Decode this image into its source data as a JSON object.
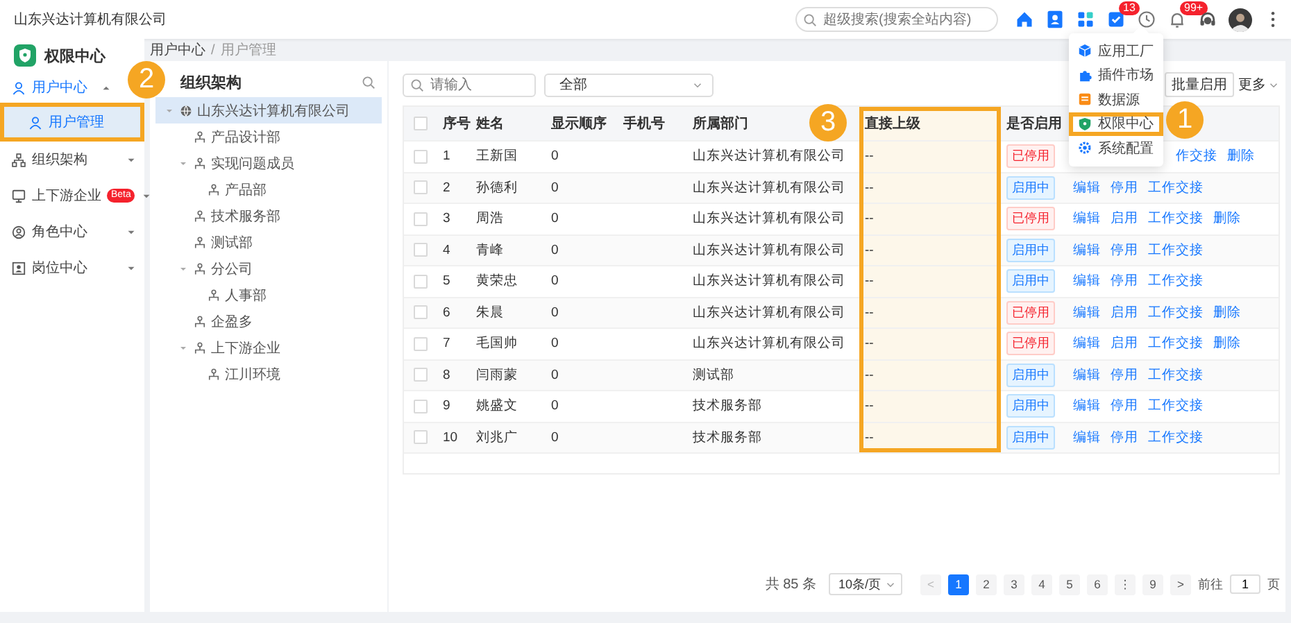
{
  "header": {
    "company": "山东兴达计算机有限公司",
    "search": {
      "placeholder": "超级搜索(搜索全站内容)"
    },
    "icons": [
      {
        "kind": "home"
      },
      {
        "kind": "contacts"
      },
      {
        "kind": "apps"
      },
      {
        "kind": "tasks",
        "badge": "13"
      },
      {
        "kind": "clock"
      },
      {
        "kind": "bell",
        "badge": "99+"
      },
      {
        "kind": "support"
      },
      {
        "kind": "avatar"
      },
      {
        "kind": "more"
      }
    ]
  },
  "menu": {
    "items": [
      {
        "label": "应用工厂",
        "selected": false
      },
      {
        "label": "插件市场",
        "selected": false
      },
      {
        "label": "数据源",
        "selected": false
      },
      {
        "label": "权限中心",
        "selected": false
      },
      {
        "label": "系统配置",
        "selected": false
      }
    ]
  },
  "sidebar": {
    "title": "权限中心",
    "items": [
      {
        "label": "用户中心",
        "expanded": true,
        "selected": false,
        "children": [
          {
            "label": "用户管理",
            "selected": true
          }
        ]
      },
      {
        "label": "组织架构",
        "expanded": false,
        "selected": false
      },
      {
        "label": "上下游企业",
        "badge": "Beta",
        "expanded": false,
        "selected": false
      },
      {
        "label": "角色中心",
        "expanded": false,
        "selected": false
      },
      {
        "label": "岗位中心",
        "expanded": false,
        "selected": false
      }
    ]
  },
  "breadcrumb": {
    "items": [
      "用户中心",
      "用户管理"
    ],
    "separator": "/"
  },
  "tree": {
    "title": "组织架构",
    "nodes": [
      {
        "label": "山东兴达计算机有限公司",
        "kind": "root",
        "selected": true,
        "expanded": true,
        "children": [
          {
            "label": "产品设计部",
            "selected": false
          },
          {
            "label": "实现问题成员",
            "selected": false,
            "expanded": true,
            "children": [
              {
                "label": "产品部",
                "selected": false
              }
            ]
          },
          {
            "label": "技术服务部",
            "selected": false
          },
          {
            "label": "测试部",
            "selected": false
          },
          {
            "label": "分公司",
            "selected": false,
            "expanded": true,
            "children": [
              {
                "label": "人事部",
                "selected": false
              }
            ]
          },
          {
            "label": "企盈多",
            "selected": false
          },
          {
            "label": "上下游企业",
            "selected": false,
            "expanded": true,
            "children": [
              {
                "label": "江川环境",
                "selected": false
              }
            ]
          }
        ]
      }
    ]
  },
  "toolbar": {
    "search": {
      "placeholder": "请输入"
    },
    "filter": {
      "value": "全部"
    },
    "buttons": [
      "批量启用"
    ],
    "more": "更多"
  },
  "table": {
    "header_checked": false,
    "columns": [
      "序号",
      "姓名",
      "显示顺序",
      "手机号",
      "所属部门",
      "直接上级",
      "是否启用"
    ],
    "rows": [
      {
        "checked": false,
        "index": "1",
        "name": "王新国",
        "order": "0",
        "department": "山东兴达计算机有限公司",
        "manager": "--",
        "status": {
          "label": "已停用",
          "kind": "stopped"
        },
        "covered": true,
        "actions": [
          "作交接",
          "删除"
        ]
      },
      {
        "checked": false,
        "index": "2",
        "name": "孙德利",
        "order": "0",
        "department": "山东兴达计算机有限公司",
        "manager": "--",
        "status": {
          "label": "启用中",
          "kind": "active"
        },
        "actions": [
          "编辑",
          "停用",
          "工作交接"
        ]
      },
      {
        "checked": false,
        "index": "3",
        "name": "周浩",
        "order": "0",
        "department": "山东兴达计算机有限公司",
        "manager": "--",
        "status": {
          "label": "已停用",
          "kind": "stopped"
        },
        "actions": [
          "编辑",
          "启用",
          "工作交接",
          "删除"
        ]
      },
      {
        "checked": false,
        "index": "4",
        "name": "青峰",
        "order": "0",
        "department": "山东兴达计算机有限公司",
        "manager": "--",
        "status": {
          "label": "启用中",
          "kind": "active"
        },
        "actions": [
          "编辑",
          "停用",
          "工作交接"
        ]
      },
      {
        "checked": false,
        "index": "5",
        "name": "黄荣忠",
        "order": "0",
        "department": "山东兴达计算机有限公司",
        "manager": "--",
        "status": {
          "label": "启用中",
          "kind": "active"
        },
        "actions": [
          "编辑",
          "停用",
          "工作交接"
        ]
      },
      {
        "checked": false,
        "index": "6",
        "name": "朱晨",
        "order": "0",
        "department": "山东兴达计算机有限公司",
        "manager": "--",
        "status": {
          "label": "已停用",
          "kind": "stopped"
        },
        "actions": [
          "编辑",
          "启用",
          "工作交接",
          "删除"
        ]
      },
      {
        "checked": false,
        "index": "7",
        "name": "毛国帅",
        "order": "0",
        "department": "山东兴达计算机有限公司",
        "manager": "--",
        "status": {
          "label": "已停用",
          "kind": "stopped"
        },
        "actions": [
          "编辑",
          "启用",
          "工作交接",
          "删除"
        ]
      },
      {
        "checked": false,
        "index": "8",
        "name": "闫雨蒙",
        "order": "0",
        "department": "测试部",
        "manager": "--",
        "status": {
          "label": "启用中",
          "kind": "active"
        },
        "actions": [
          "编辑",
          "停用",
          "工作交接"
        ]
      },
      {
        "checked": false,
        "index": "9",
        "name": "姚盛文",
        "order": "0",
        "department": "技术服务部",
        "manager": "--",
        "status": {
          "label": "启用中",
          "kind": "active"
        },
        "actions": [
          "编辑",
          "停用",
          "工作交接"
        ]
      },
      {
        "checked": false,
        "index": "10",
        "name": "刘兆广",
        "order": "0",
        "department": "技术服务部",
        "manager": "--",
        "status": {
          "label": "启用中",
          "kind": "active"
        },
        "actions": [
          "编辑",
          "停用",
          "工作交接"
        ]
      }
    ]
  },
  "pagination": {
    "total": "共 85 条",
    "page_size": "10条/页",
    "prev": "<",
    "next": ">",
    "pages": [
      {
        "label": "1",
        "selected": true
      },
      {
        "label": "2",
        "selected": false
      },
      {
        "label": "3",
        "selected": false
      },
      {
        "label": "4",
        "selected": false
      },
      {
        "label": "5",
        "selected": false
      },
      {
        "label": "6",
        "selected": false
      },
      {
        "label": "⋮",
        "selected": false
      },
      {
        "label": "9",
        "selected": false
      }
    ],
    "goto": {
      "label": "前往",
      "value": "1",
      "suffix": "页"
    }
  },
  "annotations": [
    {
      "number": "1"
    },
    {
      "number": "2"
    },
    {
      "number": "3"
    }
  ]
}
